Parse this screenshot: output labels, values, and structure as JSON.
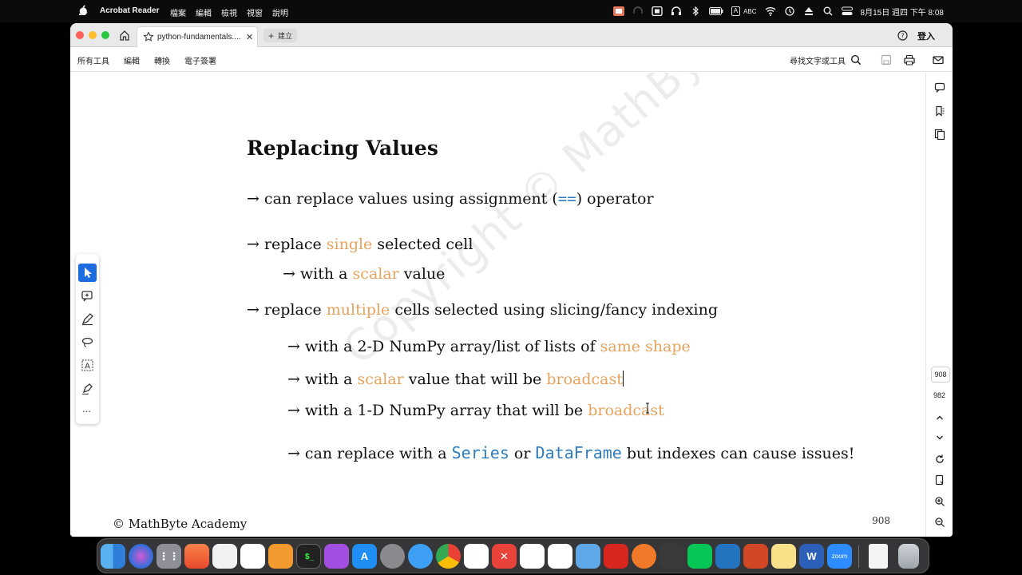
{
  "menubar": {
    "app_name": "Acrobat Reader",
    "menus": [
      "檔案",
      "編輯",
      "檢視",
      "視窗",
      "說明"
    ],
    "input_mode": "ABC",
    "input_letter": "A",
    "clock": "8月15日 週四 下午 8:08"
  },
  "tabbar": {
    "tab_title": "python-fundamentals....",
    "tab_close": "✕",
    "new_tab_label": "建立",
    "login_label": "登入"
  },
  "toolbar": {
    "menu": [
      "所有工具",
      "編輯",
      "轉換",
      "電子簽署"
    ],
    "find_label": "尋找文字或工具"
  },
  "slide": {
    "title": "Replacing Values",
    "watermark": "Copyright © MathByte Academy",
    "arrow": "→",
    "b1": {
      "pre": "can replace values using assignment (",
      "op": "==",
      "post": ") operator"
    },
    "b2": {
      "pre": "replace ",
      "hl": "single",
      "post": " selected cell"
    },
    "b2a": {
      "pre": "with a ",
      "hl": "scalar",
      "post": " value"
    },
    "b3": {
      "pre": "replace ",
      "hl": "multiple",
      "post": " cells selected using slicing/fancy indexing"
    },
    "b3a": {
      "pre": "with a 2-D NumPy array/list of lists of ",
      "hl": "same shape"
    },
    "b3b": {
      "pre": "with a ",
      "hl": "scalar",
      "mid": " value that will be ",
      "hl2": "broadcast"
    },
    "b3c": {
      "pre": "with a 1-D NumPy array that will be ",
      "hl": "broadcast"
    },
    "b3d": {
      "pre": "can replace with a ",
      "code1": "Series",
      "mid": " or ",
      "code2": "DataFrame",
      "post": " but indexes can cause issues!"
    },
    "footer_left": "© MathByte Academy",
    "footer_right": "908"
  },
  "right_rail": {
    "current_page": "908",
    "total_pages": "982"
  },
  "quick_tools": {
    "more": "..."
  },
  "colors": {
    "highlight": "#e6a35c",
    "code": "#2f7dbd",
    "active_tool": "#1c6be0"
  },
  "dock": {
    "apps": [
      "Finder",
      "Siri",
      "Launchpad",
      "Swift Playgrounds",
      "Mission Control",
      "Reminders",
      "Books",
      "Terminal",
      "Podcasts",
      "App Store",
      "System Settings",
      "Safari",
      "Chrome",
      "Slack",
      "XMind",
      "Asana",
      "Notion",
      "Preview",
      "Acrobat",
      "Proxyman",
      "Sublime Text",
      "LINE",
      "VS Code",
      "PowerPoint",
      "Notes",
      "Word",
      "Zoom",
      "Document",
      "Trash"
    ],
    "zoom_label": "zoom"
  }
}
